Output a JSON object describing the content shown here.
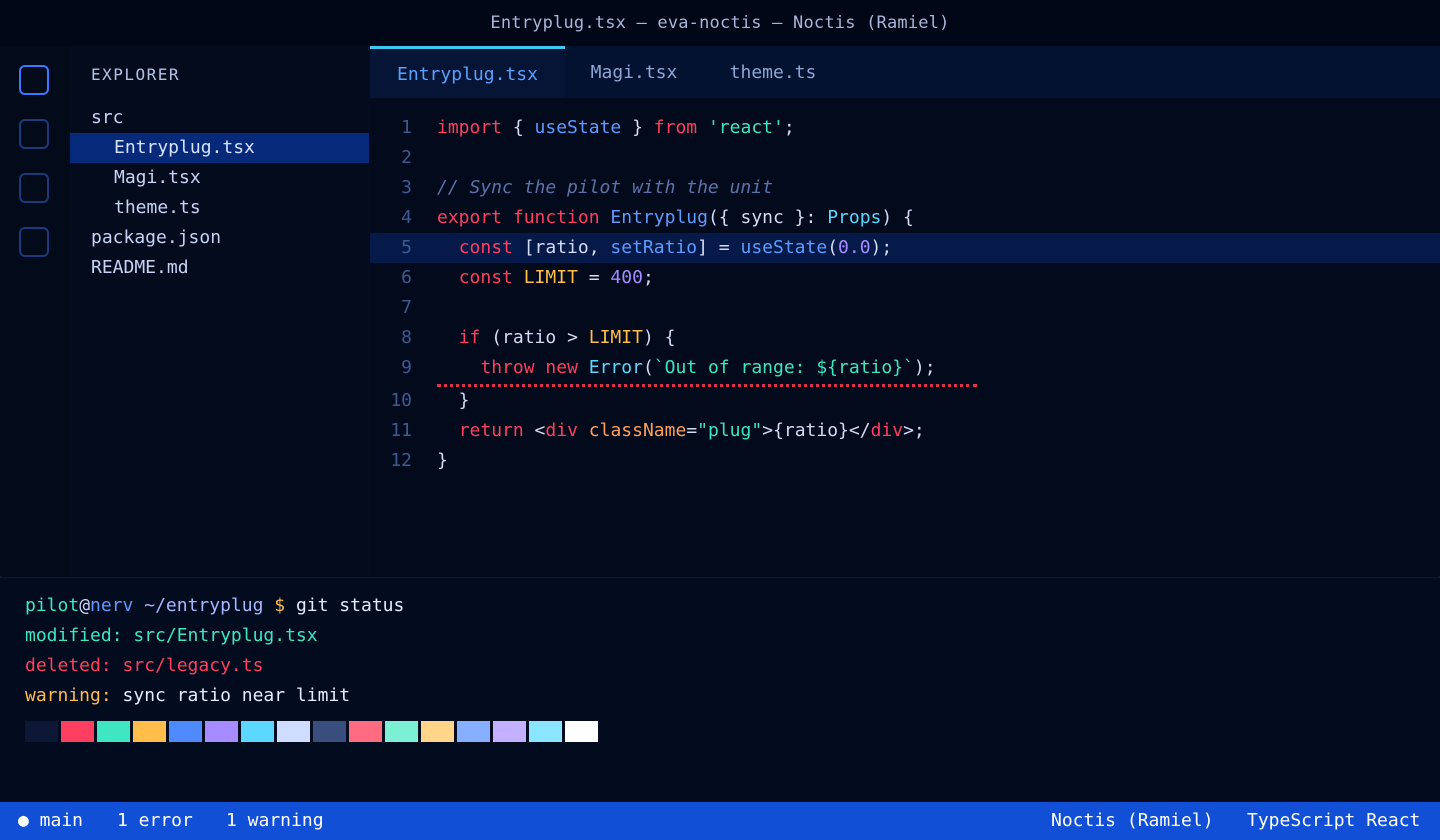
{
  "window": {
    "title": "Entryplug.tsx — eva-noctis — Noctis (Ramiel)"
  },
  "activity_bar": {
    "icons": [
      "explorer-icon",
      "search-icon",
      "source-control-icon",
      "extensions-icon"
    ]
  },
  "sidebar": {
    "title": "EXPLORER",
    "items": [
      {
        "label": "src",
        "depth": 0,
        "selected": false
      },
      {
        "label": "Entryplug.tsx",
        "depth": 1,
        "selected": true
      },
      {
        "label": "Magi.tsx",
        "depth": 1,
        "selected": false
      },
      {
        "label": "theme.ts",
        "depth": 1,
        "selected": false
      },
      {
        "label": "package.json",
        "depth": 0,
        "selected": false
      },
      {
        "label": "README.md",
        "depth": 0,
        "selected": false
      }
    ]
  },
  "tabs": [
    {
      "label": "Entryplug.tsx",
      "active": true
    },
    {
      "label": "Magi.tsx",
      "active": false
    },
    {
      "label": "theme.ts",
      "active": false
    }
  ],
  "editor": {
    "highlighted_line": 5,
    "error_line": 9,
    "lines": [
      {
        "num": "1",
        "tokens": [
          [
            "kw",
            "import"
          ],
          [
            "pl",
            " { "
          ],
          [
            "fn",
            "useState"
          ],
          [
            "pl",
            " } "
          ],
          [
            "kw",
            "from"
          ],
          [
            "pl",
            " "
          ],
          [
            "str",
            "'react'"
          ],
          [
            "pl",
            ";"
          ]
        ]
      },
      {
        "num": "2",
        "tokens": []
      },
      {
        "num": "3",
        "tokens": [
          [
            "cm",
            "// Sync the pilot with the unit"
          ]
        ]
      },
      {
        "num": "4",
        "tokens": [
          [
            "kw",
            "export"
          ],
          [
            "pl",
            " "
          ],
          [
            "kw",
            "function"
          ],
          [
            "pl",
            " "
          ],
          [
            "fn",
            "Entryplug"
          ],
          [
            "pl",
            "({ sync }: "
          ],
          [
            "ty",
            "Props"
          ],
          [
            "pl",
            ") {"
          ]
        ]
      },
      {
        "num": "5",
        "tokens": [
          [
            "pl",
            "  "
          ],
          [
            "kw",
            "const"
          ],
          [
            "pl",
            " [ratio, "
          ],
          [
            "fn",
            "setRatio"
          ],
          [
            "pl",
            "] = "
          ],
          [
            "fn",
            "useState"
          ],
          [
            "pl",
            "("
          ],
          [
            "num",
            "0.0"
          ],
          [
            "pl",
            ");"
          ]
        ]
      },
      {
        "num": "6",
        "tokens": [
          [
            "pl",
            "  "
          ],
          [
            "kw",
            "const"
          ],
          [
            "pl",
            " "
          ],
          [
            "const",
            "LIMIT"
          ],
          [
            "pl",
            " = "
          ],
          [
            "num",
            "400"
          ],
          [
            "pl",
            ";"
          ]
        ]
      },
      {
        "num": "7",
        "tokens": []
      },
      {
        "num": "8",
        "tokens": [
          [
            "pl",
            "  "
          ],
          [
            "kw",
            "if"
          ],
          [
            "pl",
            " (ratio > "
          ],
          [
            "const",
            "LIMIT"
          ],
          [
            "pl",
            ") {"
          ]
        ]
      },
      {
        "num": "9",
        "tokens": [
          [
            "pl",
            "    "
          ],
          [
            "kw",
            "throw"
          ],
          [
            "pl",
            " "
          ],
          [
            "kw",
            "new"
          ],
          [
            "pl",
            " "
          ],
          [
            "ty",
            "Error"
          ],
          [
            "pl",
            "("
          ],
          [
            "str",
            "`Out of range: ${ratio}`"
          ],
          [
            "pl",
            ");"
          ]
        ]
      },
      {
        "num": "10",
        "tokens": [
          [
            "pl",
            "  }"
          ]
        ]
      },
      {
        "num": "11",
        "tokens": [
          [
            "pl",
            "  "
          ],
          [
            "kw",
            "return"
          ],
          [
            "pl",
            " <"
          ],
          [
            "kw",
            "div"
          ],
          [
            "pl",
            " "
          ],
          [
            "attr",
            "className"
          ],
          [
            "pl",
            "="
          ],
          [
            "str",
            "\"plug\""
          ],
          [
            "pl",
            ">{ratio}</"
          ],
          [
            "kw",
            "div"
          ],
          [
            "pl",
            ">;"
          ]
        ]
      },
      {
        "num": "12",
        "tokens": [
          [
            "pl",
            "}"
          ]
        ]
      }
    ]
  },
  "terminal": {
    "prompt": {
      "user": "pilot",
      "at": "@",
      "host": "nerv",
      "path": " ~/entryplug",
      "dollar": " $",
      "command": " git status"
    },
    "modified": "modified: src/Entryplug.tsx",
    "deleted": "deleted: src/legacy.ts",
    "warning_label": "warning:",
    "warning_text": " sync ratio near limit",
    "palette": [
      "#0c1836",
      "#ff3f5f",
      "#3ee6c2",
      "#ffbd4a",
      "#4f8bff",
      "#a58bff",
      "#5cd8ff",
      "#cfdcff",
      "#3a4e7d",
      "#ff6b80",
      "#7cf0d4",
      "#ffd58a",
      "#87aeff",
      "#c3b0ff",
      "#8ae6ff",
      "#ffffff"
    ]
  },
  "status_bar": {
    "branch": "● main",
    "errors": "1 error",
    "warnings": "1 warning",
    "theme": "Noctis (Ramiel)",
    "language": "TypeScript React"
  },
  "colors": {
    "accent": "#1150d6",
    "tab_indicator": "#3cc8f0",
    "selection": "#06297a"
  }
}
